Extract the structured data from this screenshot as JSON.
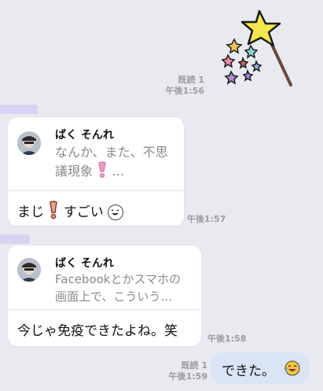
{
  "messages": {
    "m1": {
      "read": "既読 1",
      "time": "午後1:56"
    },
    "m2": {
      "sender": "ばく そんれ",
      "quoted_line1": "なんか、また、不思",
      "quoted_line2": "議現象",
      "quoted_ellipsis": "…",
      "text_before": "まじ",
      "text_after": "すごい",
      "time": "午後1:57"
    },
    "m3": {
      "sender": "ばく そんれ",
      "quoted_line1": "Facebookとかスマホの",
      "quoted_line2": "画面上で、こういう…",
      "text": "今じゃ免疫できたよね。笑",
      "time": "午後1:58"
    },
    "m4": {
      "read": "既読 1",
      "time": "午後1:59",
      "text": "できた。"
    }
  },
  "icons": {
    "sticker": "star-wand-sticker",
    "exclaim": "pink-exclamation-icon",
    "laugh": "laughing-face-icon"
  },
  "colors": {
    "background": "#e9eaf0",
    "outgoing_bubble": "#d9e4f7",
    "accent_bar": "#d7d3f2"
  }
}
